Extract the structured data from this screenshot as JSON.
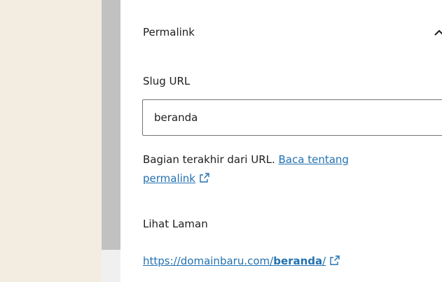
{
  "panel": {
    "title": "Permalink",
    "toggle_icon": "chevron-up-icon"
  },
  "slug": {
    "label": "Slug URL",
    "value": "beranda"
  },
  "help": {
    "text": "Bagian terakhir dari URL. ",
    "link_text_1": "Baca tentang",
    "link_text_2": "permalink",
    "link_icon": "external-link-icon"
  },
  "view": {
    "label": "Lihat Laman",
    "url_prefix": "https://domainbaru.com/",
    "url_slug": "beranda",
    "url_suffix": "/",
    "link_icon": "external-link-icon"
  },
  "colors": {
    "link": "#2271b1",
    "canvas_background": "#f3ede1",
    "scrollbar_thumb": "#c1c1c1"
  }
}
